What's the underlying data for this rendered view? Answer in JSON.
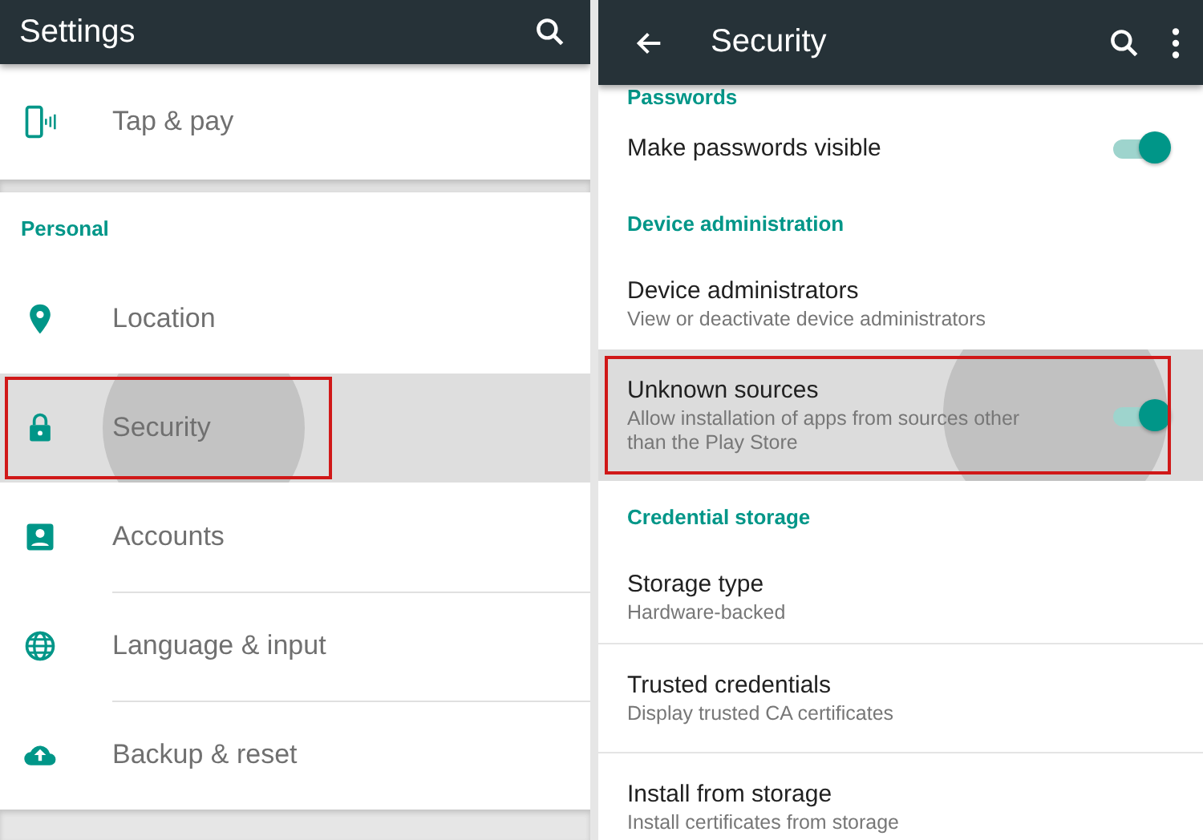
{
  "left_panel": {
    "toolbar": {
      "title": "Settings"
    },
    "sections": [
      {
        "items": [
          {
            "label": "Tap & pay",
            "selected": false,
            "annotated": false
          }
        ]
      },
      {
        "header": "Personal",
        "items": [
          {
            "label": "Location",
            "selected": false,
            "annotated": false
          },
          {
            "label": "Security",
            "selected": true,
            "annotated": true
          },
          {
            "label": "Accounts",
            "selected": false,
            "annotated": false
          },
          {
            "label": "Language & input",
            "selected": false,
            "annotated": false
          },
          {
            "label": "Backup & reset",
            "selected": false,
            "annotated": false
          }
        ]
      }
    ]
  },
  "right_panel": {
    "toolbar": {
      "title": "Security"
    },
    "sections": [
      {
        "header": "Passwords",
        "items": [
          {
            "kind": "toggle",
            "title": "Make passwords visible",
            "on": true,
            "selected": false,
            "annotated": false
          }
        ]
      },
      {
        "header": "Device administration",
        "items": [
          {
            "kind": "text",
            "title": "Device administrators",
            "subtitle": "View or deactivate device administrators",
            "selected": false,
            "annotated": false
          },
          {
            "kind": "toggle",
            "title": "Unknown sources",
            "subtitle": "Allow installation of apps from sources other than the Play Store",
            "on": true,
            "selected": true,
            "annotated": true
          }
        ]
      },
      {
        "header": "Credential storage",
        "items": [
          {
            "kind": "text",
            "title": "Storage type",
            "subtitle": "Hardware-backed",
            "selected": false,
            "annotated": false
          },
          {
            "kind": "text",
            "title": "Trusted credentials",
            "subtitle": "Display trusted CA certificates",
            "selected": false,
            "annotated": false
          },
          {
            "kind": "text",
            "title": "Install from storage",
            "subtitle": "Install certificates from storage",
            "selected": false,
            "annotated": false
          }
        ]
      }
    ]
  }
}
